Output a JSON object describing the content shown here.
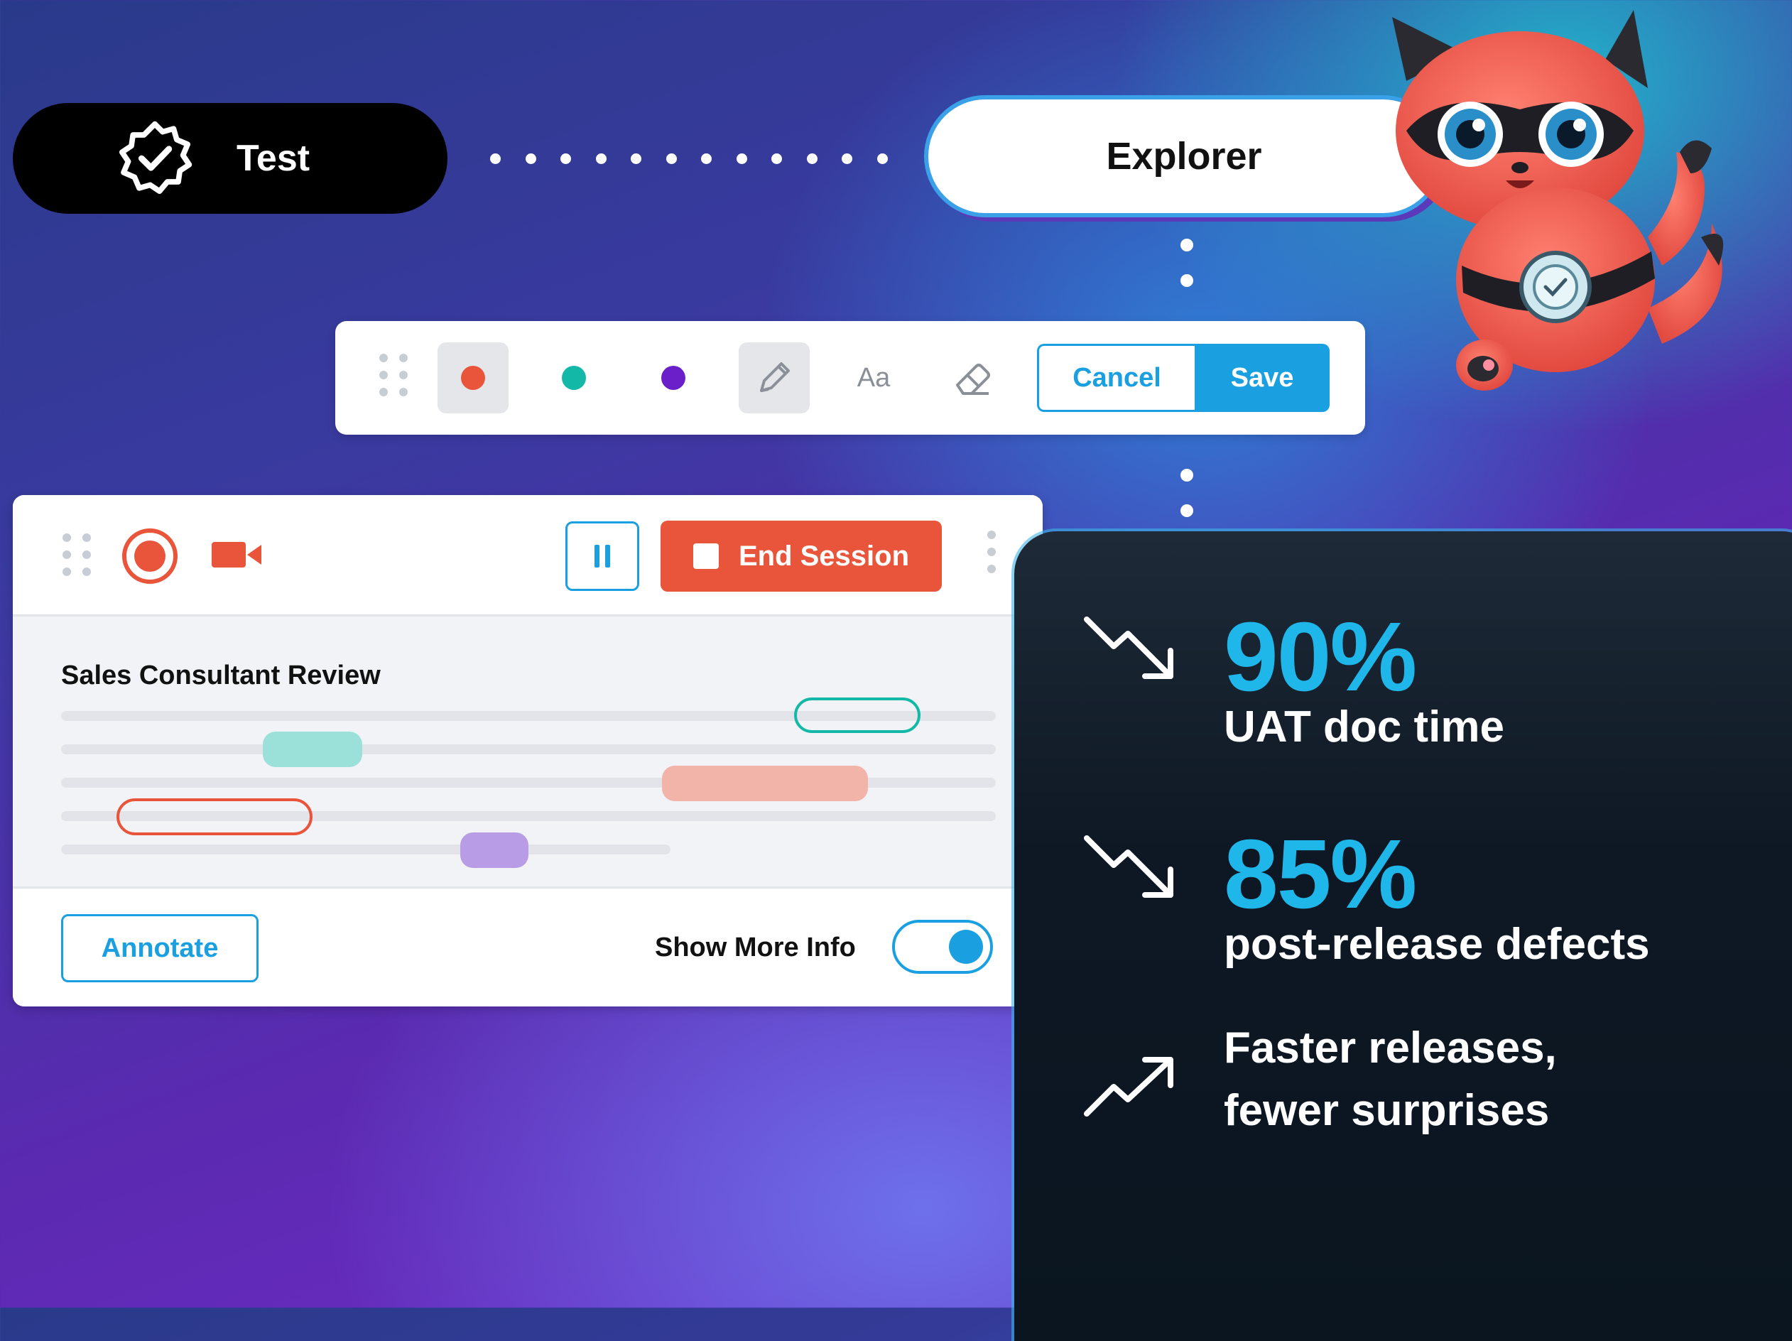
{
  "flow": {
    "test_label": "Test",
    "explorer_label": "Explorer"
  },
  "toolbar": {
    "colors": [
      "#e8553a",
      "#14b8a6",
      "#6a1fc8"
    ],
    "text_tool_label": "Aa",
    "cancel_label": "Cancel",
    "save_label": "Save"
  },
  "session": {
    "end_session_label": "End Session",
    "document_title": "Sales Consultant Review",
    "annotate_label": "Annotate",
    "show_more_info_label": "Show More Info",
    "show_more_info_on": true
  },
  "stats": [
    {
      "trend": "down",
      "value": "90%",
      "label": "UAT doc time"
    },
    {
      "trend": "down",
      "value": "85%",
      "label": "post-release defects"
    },
    {
      "trend": "up",
      "line1": "Faster releases,",
      "line2": "fewer surprises"
    }
  ],
  "colors": {
    "accent": "#1aa0e0",
    "record": "#e8553a",
    "stat_value": "#1fb6ea"
  }
}
